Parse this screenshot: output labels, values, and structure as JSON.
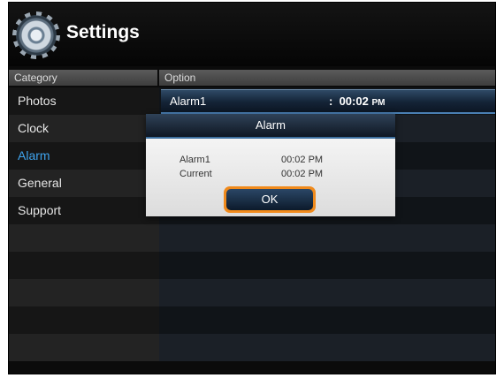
{
  "header": {
    "title": "Settings",
    "icon": "gear-icon"
  },
  "columns": {
    "category": "Category",
    "option": "Option"
  },
  "categories": [
    {
      "label": "Photos"
    },
    {
      "label": "Clock"
    },
    {
      "label": "Alarm",
      "active": true
    },
    {
      "label": "General"
    },
    {
      "label": "Support"
    }
  ],
  "option_selected": {
    "label": "Alarm1",
    "sep": ":",
    "time": "00:02",
    "ampm": "PM"
  },
  "dialog": {
    "title": "Alarm",
    "rows": [
      {
        "label": "Alarm1",
        "value": "00:02  PM"
      },
      {
        "label": "Current",
        "value": "00:02  PM"
      }
    ],
    "ok_label": "OK"
  },
  "colors": {
    "accent": "#3fa4ee",
    "button_focus": "#f08a1c"
  }
}
